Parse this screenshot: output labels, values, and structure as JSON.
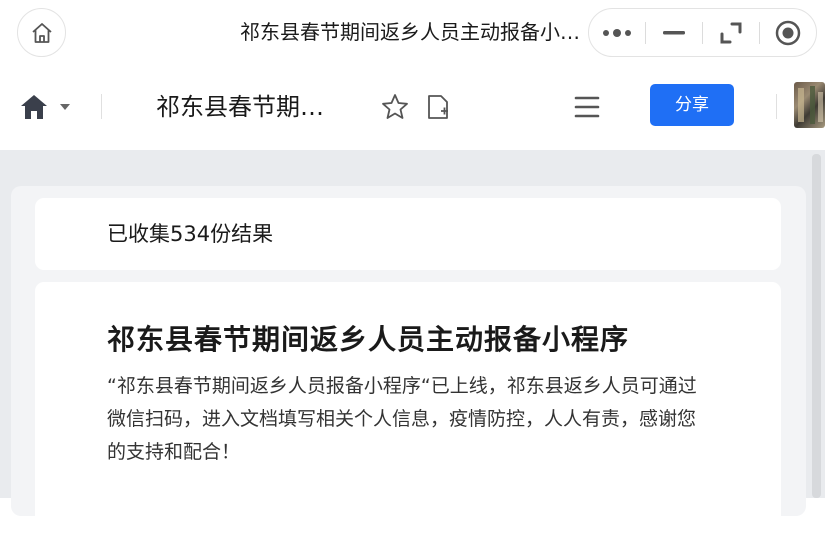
{
  "window": {
    "title": "祁东县春节期间返乡人员主动报备小程序",
    "capsule": [
      "more-icon",
      "minimize-icon",
      "restore-icon",
      "close-icon"
    ]
  },
  "toolbar": {
    "doc_title": "祁东县春节期间返乡人员主动报备小程序",
    "share_label": "分享",
    "accent": "#1f6ff5"
  },
  "summary": {
    "count_text": "已收集534份结果"
  },
  "form": {
    "title": "祁东县春节期间返乡人员主动报备小程序",
    "description": "“祁东县春节期间返乡人员报备小程序“已上线，祁东县返乡人员可通过微信扫码，进入文档填写相关个人信息，疫情防控，人人有责，感谢您的支持和配合！"
  }
}
